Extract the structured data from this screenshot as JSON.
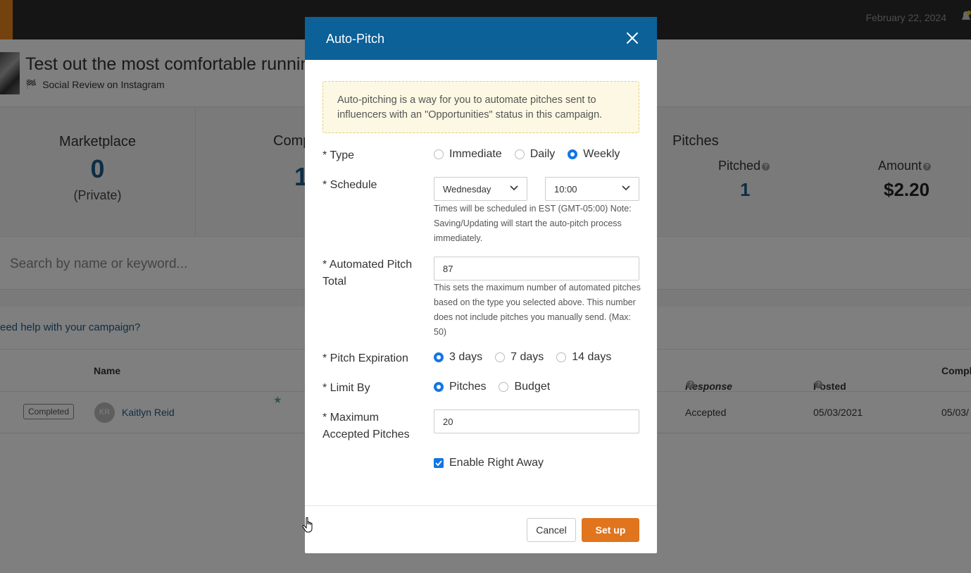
{
  "topbar": {
    "date": "February 22, 2024"
  },
  "campaign": {
    "title": "Test out the most comfortable running shoes",
    "subtitle": "Social Review on Instagram"
  },
  "stats": {
    "marketplace_label": "Marketplace",
    "marketplace_value": "0",
    "marketplace_note": "(Private)",
    "completed_label": "Comp",
    "completed_value": "1",
    "pitches_title": "Pitches",
    "pitched_label": "Pitched",
    "pitched_value": "1",
    "amount_label": "Amount",
    "amount_value": "$2.20"
  },
  "search": {
    "placeholder": "Search by name or keyword..."
  },
  "help": {
    "link": "eed help with your campaign?"
  },
  "table": {
    "headers": {
      "name": "Name",
      "response": "Response",
      "posted": "Posted",
      "completed": "Compl"
    },
    "row": {
      "status": "Completed",
      "initials": "KR",
      "name": "Kaitlyn Reid",
      "response": "Accepted",
      "posted": "05/03/2021",
      "completed": "05/03/"
    }
  },
  "modal": {
    "title": "Auto-Pitch",
    "info": "Auto-pitching is a way for you to automate pitches sent to influencers with an \"Opportunities\" status in this campaign.",
    "type": {
      "label": "* Type",
      "options": [
        "Immediate",
        "Daily",
        "Weekly"
      ],
      "selected": "Weekly"
    },
    "schedule": {
      "label": "* Schedule",
      "day": "Wednesday",
      "time": "10:00",
      "help": "Times will be scheduled in EST (GMT-05:00) Note: Saving/Updating will start the auto-pitch process immediately."
    },
    "total": {
      "label": "* Automated Pitch Total",
      "value": "87",
      "help": "This sets the maximum number of automated pitches based on the type you selected above. This number does not include pitches you manually send. (Max: 50)"
    },
    "expiration": {
      "label": "* Pitch Expiration",
      "options": [
        "3 days",
        "7 days",
        "14 days"
      ],
      "selected": "3 days"
    },
    "limit": {
      "label": "* Limit By",
      "options": [
        "Pitches",
        "Budget"
      ],
      "selected": "Pitches"
    },
    "max_accepted": {
      "label": "* Maximum Accepted Pitches",
      "value": "20"
    },
    "enable": {
      "label": "Enable Right Away",
      "checked": true
    },
    "cancel_label": "Cancel",
    "setup_label": "Set up"
  },
  "colors": {
    "header_blue": "#0b6198",
    "accent_orange": "#e0751e",
    "radio_blue": "#1275e6",
    "stat_blue": "#1a5d8a"
  }
}
